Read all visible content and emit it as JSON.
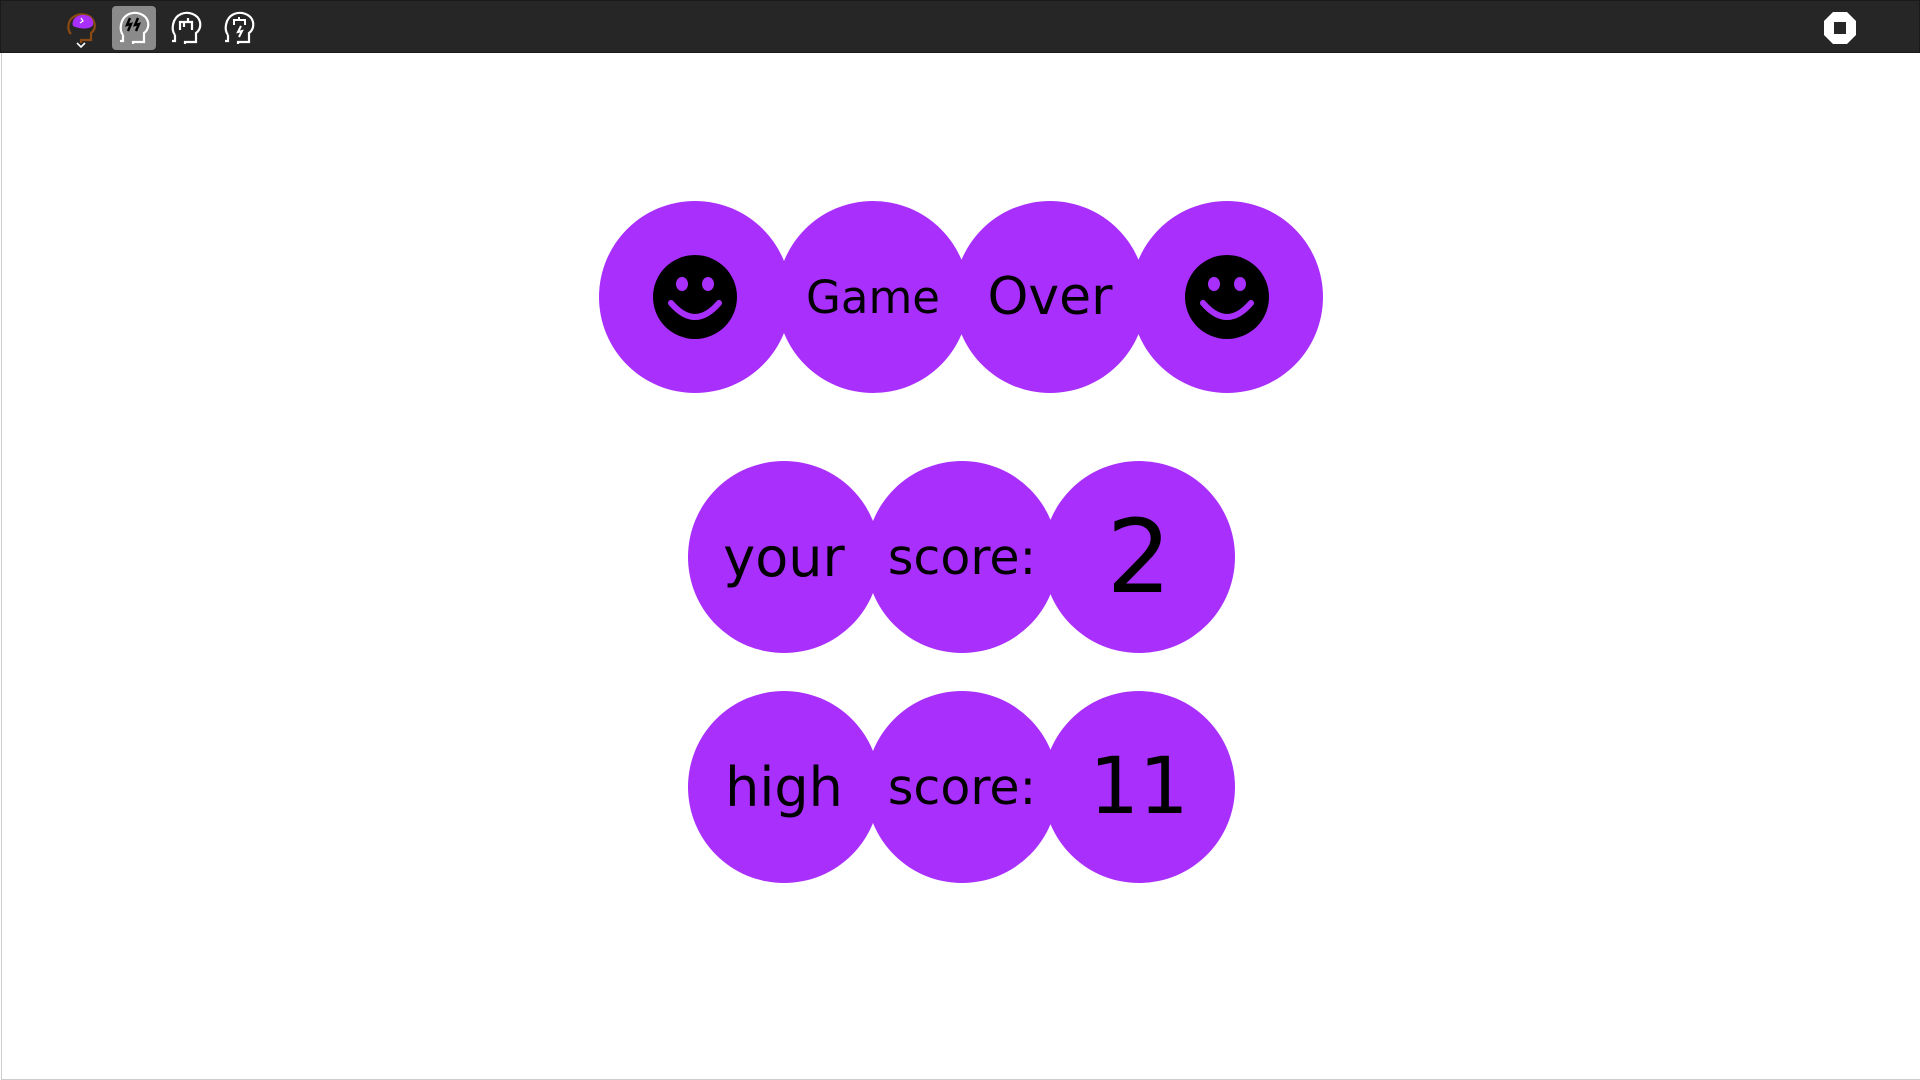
{
  "colors": {
    "bubble": "#a92ffd",
    "topbar": "#262626",
    "text": "#000000",
    "stop_button": "#ffffff"
  },
  "toolbar": {
    "buttons": [
      {
        "icon": "brain-menu-icon",
        "selected": false
      },
      {
        "icon": "head-lightning-icon",
        "selected": true
      },
      {
        "icon": "head-robot-icon",
        "selected": false
      },
      {
        "icon": "head-robot-lightning-icon",
        "selected": false
      }
    ],
    "stop_icon": "stop-icon"
  },
  "game": {
    "title_row": {
      "left_icon": "smiley-icon",
      "word1": "Game",
      "word2": "Over",
      "right_icon": "smiley-icon"
    },
    "your_score": {
      "word1": "your",
      "word2": "score:",
      "value": "2"
    },
    "high_score": {
      "word1": "high",
      "word2": "score:",
      "value": "11"
    }
  }
}
